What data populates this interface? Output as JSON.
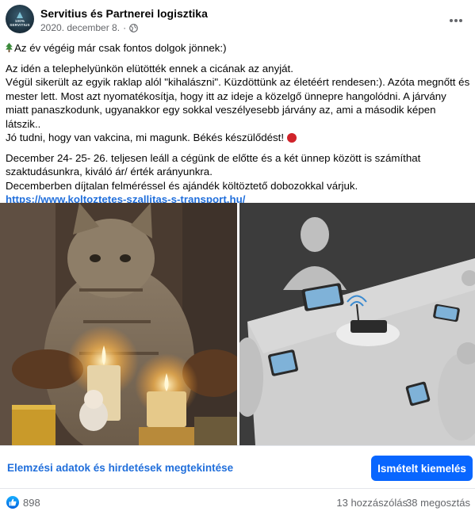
{
  "post": {
    "author": "Servitius és Partnerei logisztika",
    "date": "2020. december 8.",
    "separator": "·",
    "avatar": {
      "line1": "100%",
      "line2": "SERVITIUS"
    },
    "paragraphs": {
      "p1": "Az év végéig már csak fontos dolgok jönnek:)",
      "p2_l1": "Az idén a telephelyünkön elütötték ennek a cicának az anyját.",
      "p2_l2": "Végül sikerült az egyik raklap alól \"kihalászni\". Küzdöttünk az életéért rendesen:). Azóta megnőtt és",
      "p2_l3": "mester lett.  Most azt nyomatékosítja, hogy itt az ideje a közelgő ünnepre hangolódni. A járvány",
      "p2_l4": "miatt panaszkodunk, ugyanakkor egy sokkal veszélyesebb járvány az, ami a második képen látszik..",
      "p2_l5": "Jó tudni, hogy van vakcina, mi magunk. Békés készülődést!",
      "p3_l1": "December 24- 25- 26. teljesen leáll a cégünk de előtte és a két ünnep között is számíthat",
      "p3_l2": "szaktudásunkra, kiváló ár/ érték arányunkra.",
      "p3_l3": "Decemberben díjtalan felméréssel és ajándék költöztető dobozokkal várjuk.",
      "link": "https://www.koltoztetes-szallitas-s-transport.hu/"
    }
  },
  "actions": {
    "insights": "Elemzési adatok és hirdetések megtekintése",
    "boost": "Ismételt kiemelés"
  },
  "stats": {
    "likes": "898",
    "comments": "13 hozzászólás",
    "shares": "38 megosztás"
  },
  "colors": {
    "link": "#216fdb",
    "boost_button": "#0866ff",
    "muted_text": "#65676b"
  },
  "icons": [
    "globe-icon",
    "more-icon",
    "tree-emoji-icon",
    "red-heart-emoji-icon",
    "like-icon"
  ]
}
